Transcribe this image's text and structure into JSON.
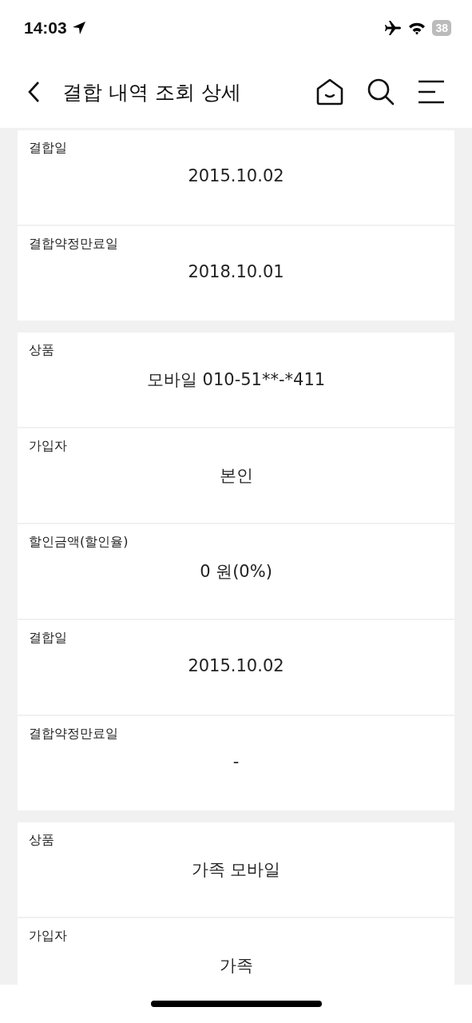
{
  "status_bar": {
    "time": "14:03",
    "battery": "38"
  },
  "header": {
    "title": "결합 내역 조회 상세"
  },
  "sections": [
    {
      "rows": [
        {
          "label": "결합일",
          "value": "2015.10.02"
        },
        {
          "label": "결합약정만료일",
          "value": "2018.10.01"
        }
      ]
    },
    {
      "rows": [
        {
          "label": "상품",
          "value": "모바일 010-51**-*411"
        },
        {
          "label": "가입자",
          "value": "본인"
        },
        {
          "label": "할인금액(할인율)",
          "value": "0 원(0%)"
        },
        {
          "label": "결합일",
          "value": "2015.10.02"
        },
        {
          "label": "결합약정만료일",
          "value": "-"
        }
      ]
    },
    {
      "rows": [
        {
          "label": "상품",
          "value": "가족 모바일"
        },
        {
          "label": "가입자",
          "value": "가족"
        }
      ]
    }
  ]
}
